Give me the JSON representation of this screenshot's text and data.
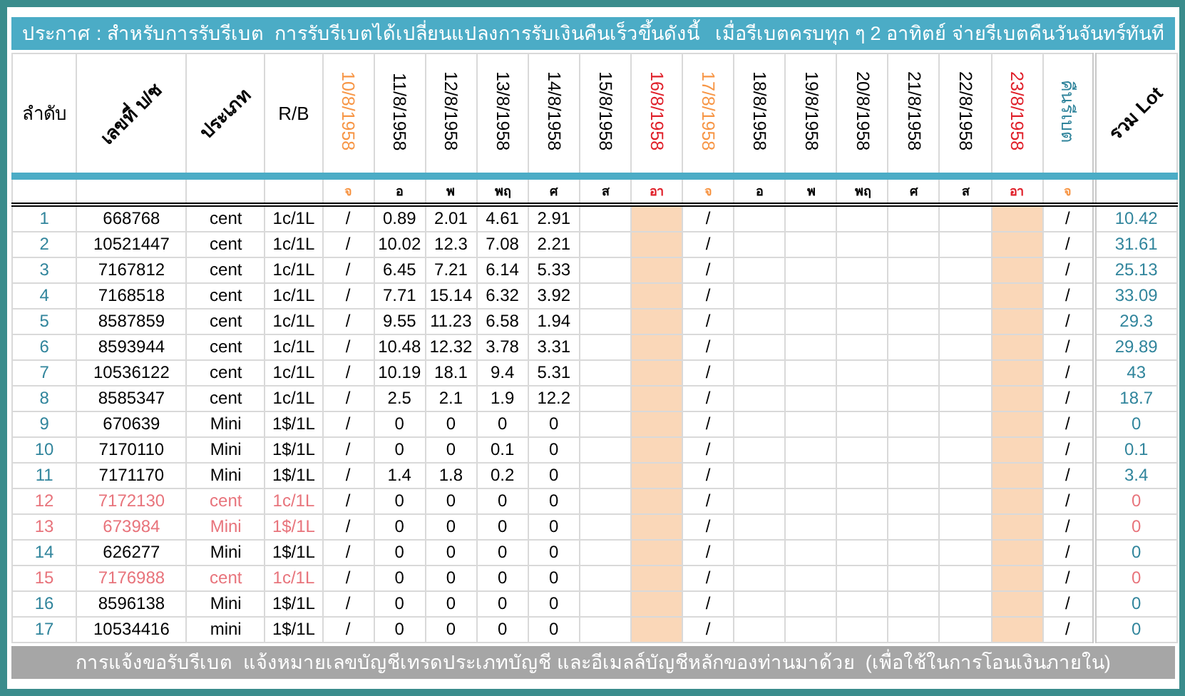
{
  "banner": {
    "text": "ประกาศ : สำหรับการรับรีเบต  การรับรีเบตได้เปลี่ยนแปลงการรับเงินคืนเร็วขึ้นดังนี้   เมื่อรีเบตครบทุก ๆ 2 อาทิตย์ จ่ายรีเบตคืนวันจันทร์ทันที"
  },
  "columns": [
    {
      "label": "ลำดับ",
      "kind": "plain"
    },
    {
      "label": "เลขที่ บ/ช",
      "kind": "slanted"
    },
    {
      "label": "ประเภท",
      "kind": "slanted"
    },
    {
      "label": "R/B",
      "kind": "plain"
    },
    {
      "label": "10/8/1958",
      "kind": "date",
      "color": "#f79646",
      "shaded": false
    },
    {
      "label": "11/8/1958",
      "kind": "date",
      "color": "#000000",
      "shaded": false
    },
    {
      "label": "12/8/1958",
      "kind": "date",
      "color": "#000000",
      "shaded": false
    },
    {
      "label": "13/8/1958",
      "kind": "date",
      "color": "#000000",
      "shaded": false
    },
    {
      "label": "14/8/1958",
      "kind": "date",
      "color": "#000000",
      "shaded": false
    },
    {
      "label": "15/8/1958",
      "kind": "date",
      "color": "#000000",
      "shaded": false
    },
    {
      "label": "16/8/1958",
      "kind": "date",
      "color": "#e0202a",
      "shaded": true
    },
    {
      "label": "17/8/1958",
      "kind": "date",
      "color": "#f79646",
      "shaded": false
    },
    {
      "label": "18/8/1958",
      "kind": "date",
      "color": "#000000",
      "shaded": false
    },
    {
      "label": "19/8/1958",
      "kind": "date",
      "color": "#000000",
      "shaded": false
    },
    {
      "label": "20/8/1958",
      "kind": "date",
      "color": "#000000",
      "shaded": false
    },
    {
      "label": "21/8/1958",
      "kind": "date",
      "color": "#000000",
      "shaded": false
    },
    {
      "label": "22/8/1958",
      "kind": "date",
      "color": "#000000",
      "shaded": false
    },
    {
      "label": "23/8/1958",
      "kind": "date",
      "color": "#e0202a",
      "shaded": true
    },
    {
      "label": "คืนรีเบต",
      "kind": "date",
      "color": "#31859c",
      "shaded": false
    },
    {
      "label": "รวม Lot",
      "kind": "total"
    }
  ],
  "days": [
    {
      "label": "จ",
      "color": "#f79646"
    },
    {
      "label": "อ",
      "color": "#000000"
    },
    {
      "label": "พ",
      "color": "#000000"
    },
    {
      "label": "พฤ",
      "color": "#000000"
    },
    {
      "label": "ศ",
      "color": "#000000"
    },
    {
      "label": "ส",
      "color": "#000000"
    },
    {
      "label": "อา",
      "color": "#e0202a"
    },
    {
      "label": "จ",
      "color": "#f79646"
    },
    {
      "label": "อ",
      "color": "#000000"
    },
    {
      "label": "พ",
      "color": "#000000"
    },
    {
      "label": "พฤ",
      "color": "#000000"
    },
    {
      "label": "ศ",
      "color": "#000000"
    },
    {
      "label": "ส",
      "color": "#000000"
    },
    {
      "label": "อา",
      "color": "#e0202a"
    },
    {
      "label": "จ",
      "color": "#f79646"
    }
  ],
  "rows": [
    {
      "no": "1",
      "account": "668768",
      "type": "cent",
      "rb": "1c/1L",
      "cells": [
        "/",
        "0.89",
        "2.01",
        "4.61",
        "2.91",
        null,
        null,
        "/",
        null,
        null,
        null,
        null,
        null,
        null,
        "/"
      ],
      "total": "10.42",
      "inactive": false
    },
    {
      "no": "2",
      "account": "10521447",
      "type": "cent",
      "rb": "1c/1L",
      "cells": [
        "/",
        "10.02",
        "12.3",
        "7.08",
        "2.21",
        null,
        null,
        "/",
        null,
        null,
        null,
        null,
        null,
        null,
        "/"
      ],
      "total": "31.61",
      "inactive": false
    },
    {
      "no": "3",
      "account": "7167812",
      "type": "cent",
      "rb": "1c/1L",
      "cells": [
        "/",
        "6.45",
        "7.21",
        "6.14",
        "5.33",
        null,
        null,
        "/",
        null,
        null,
        null,
        null,
        null,
        null,
        "/"
      ],
      "total": "25.13",
      "inactive": false
    },
    {
      "no": "4",
      "account": "7168518",
      "type": "cent",
      "rb": "1c/1L",
      "cells": [
        "/",
        "7.71",
        "15.14",
        "6.32",
        "3.92",
        null,
        null,
        "/",
        null,
        null,
        null,
        null,
        null,
        null,
        "/"
      ],
      "total": "33.09",
      "inactive": false
    },
    {
      "no": "5",
      "account": "8587859",
      "type": "cent",
      "rb": "1c/1L",
      "cells": [
        "/",
        "9.55",
        "11.23",
        "6.58",
        "1.94",
        null,
        null,
        "/",
        null,
        null,
        null,
        null,
        null,
        null,
        "/"
      ],
      "total": "29.3",
      "inactive": false
    },
    {
      "no": "6",
      "account": "8593944",
      "type": "cent",
      "rb": "1c/1L",
      "cells": [
        "/",
        "10.48",
        "12.32",
        "3.78",
        "3.31",
        null,
        null,
        "/",
        null,
        null,
        null,
        null,
        null,
        null,
        "/"
      ],
      "total": "29.89",
      "inactive": false
    },
    {
      "no": "7",
      "account": "10536122",
      "type": "cent",
      "rb": "1c/1L",
      "cells": [
        "/",
        "10.19",
        "18.1",
        "9.4",
        "5.31",
        null,
        null,
        "/",
        null,
        null,
        null,
        null,
        null,
        null,
        "/"
      ],
      "total": "43",
      "inactive": false
    },
    {
      "no": "8",
      "account": "8585347",
      "type": "cent",
      "rb": "1c/1L",
      "cells": [
        "/",
        "2.5",
        "2.1",
        "1.9",
        "12.2",
        null,
        null,
        "/",
        null,
        null,
        null,
        null,
        null,
        null,
        "/"
      ],
      "total": "18.7",
      "inactive": false
    },
    {
      "no": "9",
      "account": "670639",
      "type": "Mini",
      "rb": "1$/1L",
      "cells": [
        "/",
        "0",
        "0",
        "0",
        "0",
        null,
        null,
        "/",
        null,
        null,
        null,
        null,
        null,
        null,
        "/"
      ],
      "total": "0",
      "inactive": false
    },
    {
      "no": "10",
      "account": "7170110",
      "type": "Mini",
      "rb": "1$/1L",
      "cells": [
        "/",
        "0",
        "0",
        "0.1",
        "0",
        null,
        null,
        "/",
        null,
        null,
        null,
        null,
        null,
        null,
        "/"
      ],
      "total": "0.1",
      "inactive": false
    },
    {
      "no": "11",
      "account": "7171170",
      "type": "Mini",
      "rb": "1$/1L",
      "cells": [
        "/",
        "1.4",
        "1.8",
        "0.2",
        "0",
        null,
        null,
        "/",
        null,
        null,
        null,
        null,
        null,
        null,
        "/"
      ],
      "total": "3.4",
      "inactive": false
    },
    {
      "no": "12",
      "account": "7172130",
      "type": "cent",
      "rb": "1c/1L",
      "cells": [
        "/",
        "0",
        "0",
        "0",
        "0",
        null,
        null,
        "/",
        null,
        null,
        null,
        null,
        null,
        null,
        "/"
      ],
      "total": "0",
      "inactive": true
    },
    {
      "no": "13",
      "account": "673984",
      "type": "Mini",
      "rb": "1$/1L",
      "cells": [
        "/",
        "0",
        "0",
        "0",
        "0",
        null,
        null,
        "/",
        null,
        null,
        null,
        null,
        null,
        null,
        "/"
      ],
      "total": "0",
      "inactive": true
    },
    {
      "no": "14",
      "account": "626277",
      "type": "Mini",
      "rb": "1$/1L",
      "cells": [
        "/",
        "0",
        "0",
        "0",
        "0",
        null,
        null,
        "/",
        null,
        null,
        null,
        null,
        null,
        null,
        "/"
      ],
      "total": "0",
      "inactive": false
    },
    {
      "no": "15",
      "account": "7176988",
      "type": "cent",
      "rb": "1c/1L",
      "cells": [
        "/",
        "0",
        "0",
        "0",
        "0",
        null,
        null,
        "/",
        null,
        null,
        null,
        null,
        null,
        null,
        "/"
      ],
      "total": "0",
      "inactive": true
    },
    {
      "no": "16",
      "account": "8596138",
      "type": "Mini",
      "rb": "1$/1L",
      "cells": [
        "/",
        "0",
        "0",
        "0",
        "0",
        null,
        null,
        "/",
        null,
        null,
        null,
        null,
        null,
        null,
        "/"
      ],
      "total": "0",
      "inactive": false
    },
    {
      "no": "17",
      "account": "10534416",
      "type": "mini",
      "rb": "1$/1L",
      "cells": [
        "/",
        "0",
        "0",
        "0",
        "0",
        null,
        null,
        "/",
        null,
        null,
        null,
        null,
        null,
        null,
        "/"
      ],
      "total": "0",
      "inactive": false
    }
  ],
  "footer": {
    "text": "การแจ้งขอรับรีเบต  แจ้งหมายเลขบัญชีเทรดประเภทบัญชี และอีเมลล์บัญชีหลักของท่านมาด้วย  (เพื่อใช้ในการโอนเงินภายใน)"
  }
}
